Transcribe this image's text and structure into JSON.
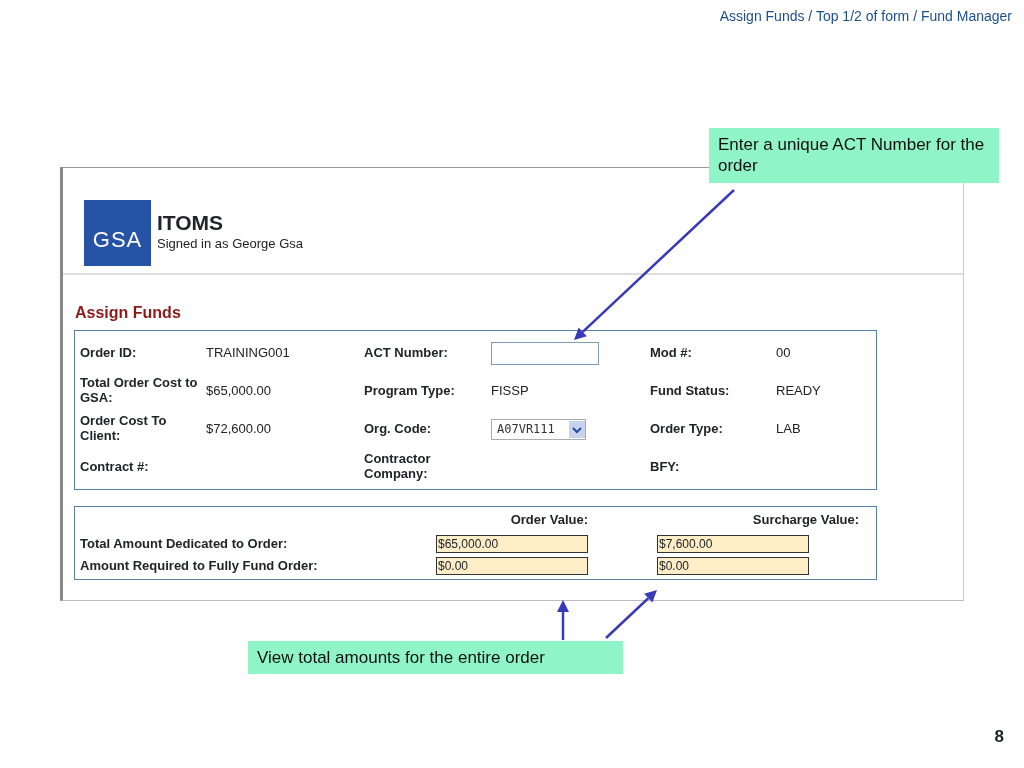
{
  "slide_title": "Assign Funds / Top 1/2 of form / Fund Manager",
  "app": {
    "logo": "GSA",
    "title": "ITOMS",
    "signed_in": "Signed in as George Gsa"
  },
  "page_heading": "Assign Funds",
  "order_fields": [
    {
      "label": "Order ID:",
      "value": "TRAINING001",
      "kind": "text"
    },
    {
      "label": "ACT Number:",
      "kind": "input"
    },
    {
      "label": "Mod #:",
      "value": "00",
      "kind": "text"
    },
    {
      "label": "Total Order Cost to GSA:",
      "value": "$65,000.00",
      "kind": "text"
    },
    {
      "label": "Program Type:",
      "value": "FISSP",
      "kind": "text"
    },
    {
      "label": "Fund Status:",
      "value": "READY",
      "kind": "text"
    },
    {
      "label": "Order Cost To Client:",
      "value": "$72,600.00",
      "kind": "text"
    },
    {
      "label": "Org. Code:",
      "value": "A07VR111",
      "kind": "select"
    },
    {
      "label": "Order Type:",
      "value": "LAB",
      "kind": "text"
    },
    {
      "label": "Contract #:",
      "kind": "text"
    },
    {
      "label": "Contractor Company:",
      "kind": "text"
    },
    {
      "label": "BFY:",
      "kind": "text"
    }
  ],
  "totals": {
    "columns": [
      "Order Value:",
      "Surcharge Value:"
    ],
    "rows": [
      {
        "label": "Total Amount Dedicated to Order:",
        "values": [
          "$65,000.00",
          "$7,600.00"
        ]
      },
      {
        "label": "Amount Required to Fully Fund Order:",
        "values": [
          "$0.00",
          "$0.00"
        ]
      }
    ]
  },
  "callouts": [
    "Enter a unique ACT Number for the order",
    "View total amounts for the entire order"
  ],
  "page_number": "8"
}
